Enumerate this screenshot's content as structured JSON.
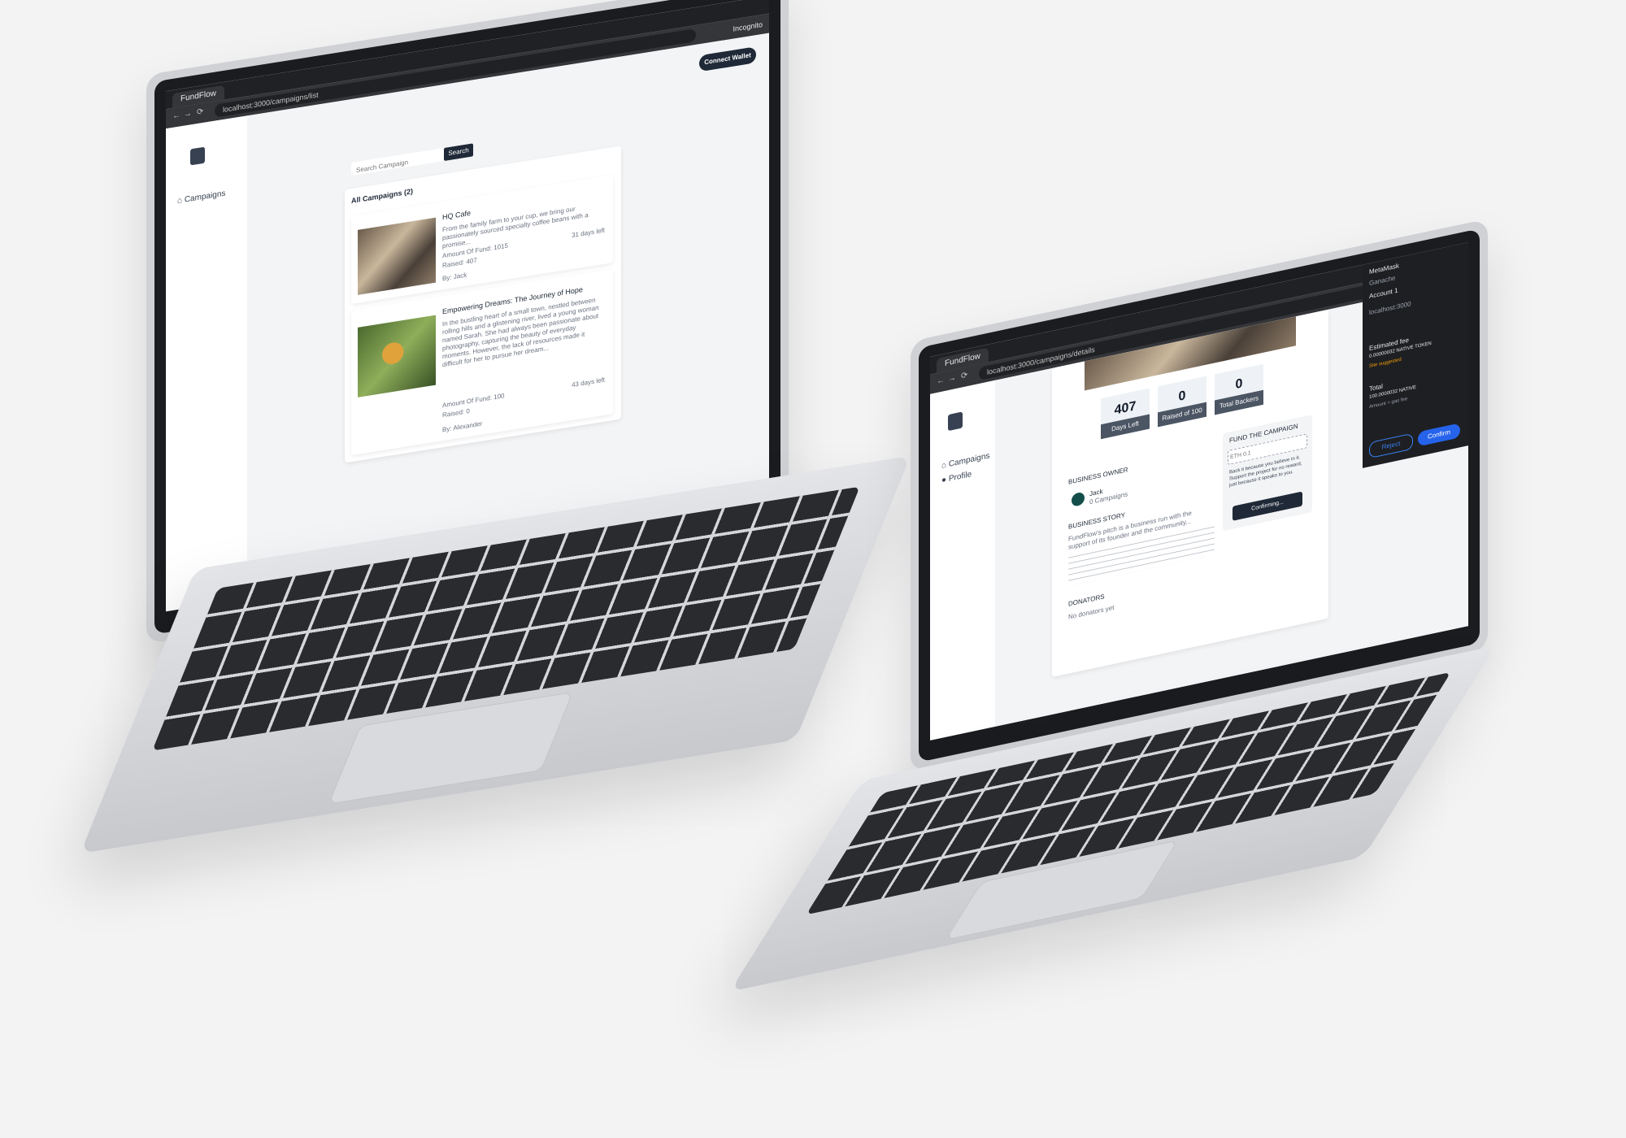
{
  "left_window": {
    "tab_title": "FundFlow",
    "url": "localhost:3000/campaigns/list",
    "incognito_label": "Incognito",
    "brand": "FundFlow",
    "sidebar": {
      "items": [
        {
          "label": "Campaigns",
          "icon": "home-icon"
        }
      ]
    },
    "header": {
      "connect_label": "Connect Wallet"
    },
    "search": {
      "placeholder": "Search Campaign",
      "button_label": "Search"
    },
    "list_title": "All Campaigns (2)",
    "campaigns": [
      {
        "title": "HQ Cafe",
        "description": "From the family farm to your cup, we bring our passionately sourced specialty coffee beans with a promise...",
        "amount": "Amount Of Fund: 1015",
        "raised": "Raised: 407",
        "date": "31 days left",
        "owner": "By: Jack"
      },
      {
        "title": "Empowering Dreams: The Journey of Hope",
        "description": "In the bustling heart of a small town, nestled between rolling hills and a glistening river, lived a young woman named Sarah. She had always been passionate about photography, capturing the beauty of everyday moments. However, the lack of resources made it difficult for her to pursue her dream...",
        "amount": "Amount Of Fund: 100",
        "raised": "Raised: 0",
        "date": "43 days left",
        "owner": "By: Alexander"
      }
    ]
  },
  "right_window": {
    "tab_title": "FundFlow",
    "url": "localhost:3000/campaigns/details",
    "sidebar": {
      "items": [
        {
          "label": "Campaigns",
          "icon": "home-icon"
        },
        {
          "label": "Profile",
          "icon": "user-icon"
        }
      ]
    },
    "stats": [
      {
        "value": "407",
        "label": "Days Left"
      },
      {
        "value": "0",
        "label": "Raised of 100"
      },
      {
        "value": "0",
        "label": "Total Backers"
      }
    ],
    "owner_heading": "BUSINESS OWNER",
    "owner_name": "Jack",
    "owner_sub": "0 Campaigns",
    "story_heading": "BUSINESS STORY",
    "story_text": "FundFlow's pitch is a business run with the support of its founder and the community...",
    "donators_heading": "DONATORS",
    "donators_text": "No donators yet",
    "fund": {
      "heading": "FUND THE CAMPAIGN",
      "input_placeholder": "ETH 0.1",
      "note": "Back it because you believe in it. Support the project for no reward, just because it speaks to you.",
      "button_label": "Confirming..."
    },
    "wallet": {
      "title": "MetaMask",
      "network": "Ganache",
      "account": "Account 1",
      "site": "localhost:3000",
      "estimated_fee_label": "Estimated fee",
      "estimated_fee_value": "0.00000032 NATIVE TOKEN",
      "site_suggested_label": "Site suggested",
      "total_label": "Total",
      "total_value": "100.0000032 NATIVE",
      "amount_fee_label": "Amount + gas fee",
      "reject_label": "Reject",
      "confirm_label": "Confirm"
    }
  }
}
